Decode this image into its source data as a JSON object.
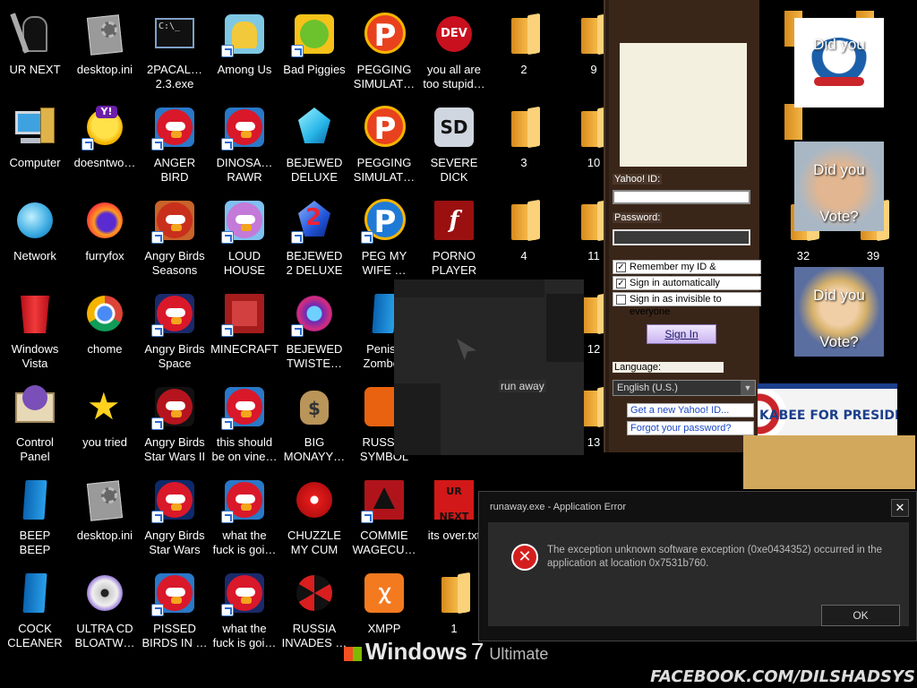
{
  "desktop": {
    "columns": [
      [
        {
          "label": "UR NEXT",
          "icon": "reaper-icon"
        },
        {
          "label": "Computer",
          "icon": "computer-icon"
        },
        {
          "label": "Network",
          "icon": "network-icon"
        },
        {
          "label": "Windows\nVista",
          "icon": "recycle-bin-icon"
        },
        {
          "label": "Control\nPanel",
          "icon": "control-panel-icon"
        },
        {
          "label": "BEEP\nBEEP",
          "icon": "blue-file-icon"
        },
        {
          "label": "COCK\nCLEANER",
          "icon": "blue-file-icon"
        }
      ],
      [
        {
          "label": "desktop.ini",
          "icon": "config-file-icon"
        },
        {
          "label": "doesntwo…",
          "icon": "yahoo-messenger-icon"
        },
        {
          "label": "furryfox",
          "icon": "firefox-icon"
        },
        {
          "label": "chome",
          "icon": "chrome-icon"
        },
        {
          "label": "you tried",
          "icon": "gold-star-icon"
        },
        {
          "label": "desktop.ini",
          "icon": "config-file-icon"
        },
        {
          "label": "ULTRA CD\nBLOATW…",
          "icon": "cd-icon"
        }
      ],
      [
        {
          "label": "2PACAL…\n2.3.exe",
          "icon": "terminal-icon"
        },
        {
          "label": "ANGER\nBIRD",
          "icon": "angry-bird-icon"
        },
        {
          "label": "Angry Birds\nSeasons",
          "icon": "angry-birds-seasons-icon"
        },
        {
          "label": "Angry Birds\nSpace",
          "icon": "angry-birds-space-icon"
        },
        {
          "label": "Angry Birds\nStar Wars II",
          "icon": "angry-birds-star-wars-icon"
        },
        {
          "label": "Angry Birds\nStar Wars",
          "icon": "angry-birds-star-wars-icon"
        },
        {
          "label": "PISSED\nBIRDS IN …",
          "icon": "angry-bird-icon"
        }
      ],
      [
        {
          "label": "Among Us",
          "icon": "among-us-icon"
        },
        {
          "label": "DINOSA…\nRAWR",
          "icon": "angry-bird-icon"
        },
        {
          "label": "LOUD\nHOUSE",
          "icon": "angry-birds-rio-icon"
        },
        {
          "label": "MINECRAFT",
          "icon": "minecraft-icon"
        },
        {
          "label": "this should\nbe on vine…",
          "icon": "angry-bird-icon"
        },
        {
          "label": "what the\nfuck is goi…",
          "icon": "angry-bird-icon"
        },
        {
          "label": "what the\nfuck is goi…",
          "icon": "angry-birds-space-icon"
        }
      ],
      [
        {
          "label": "Bad Piggies",
          "icon": "bad-piggies-icon"
        },
        {
          "label": "BEJEWED\nDELUXE",
          "icon": "diamond-icon"
        },
        {
          "label": "BEJEWED\n2 DELUXE",
          "icon": "bejeweled-2-icon"
        },
        {
          "label": "BEJEWED\nTWISTE…",
          "icon": "bejeweled-twist-icon"
        },
        {
          "label": "BIG\nMONAYY…",
          "icon": "money-bag-icon"
        },
        {
          "label": "CHUZZLE\nMY CUM",
          "icon": "chuzzle-icon"
        },
        {
          "label": "RUSSIA\nINVADES …",
          "icon": "radiation-icon"
        }
      ],
      [
        {
          "label": "PEGGING\nSIMULAT…",
          "icon": "peggle-icon"
        },
        {
          "label": "PEGGING\nSIMULAT…",
          "icon": "peggle-icon"
        },
        {
          "label": "PEG MY\nWIFE …",
          "icon": "peggle-icon"
        },
        {
          "label": "Penise\nZomboc",
          "icon": "blue-file-icon"
        },
        {
          "label": "RUSS…\nSYMBOL",
          "icon": "orange-icon"
        },
        {
          "label": "COMMIE\nWAGECU…",
          "icon": "commie-icon"
        },
        {
          "label": "XMPP",
          "icon": "xampp-icon"
        }
      ],
      [
        {
          "label": "you all are\ntoo stupid…",
          "icon": "dev-cpp-icon"
        },
        {
          "label": "SEVERE\nDICK",
          "icon": "sd-icon"
        },
        {
          "label": "PORNO\nPLAYER",
          "icon": "flash-icon"
        },
        {
          "label": "its over.txt",
          "icon": "ur-next-icon"
        },
        {
          "label": "1",
          "icon": "folder-icon"
        }
      ],
      [
        {
          "label": "2",
          "icon": "folder-icon"
        },
        {
          "label": "3",
          "icon": "folder-icon"
        },
        {
          "label": "4",
          "icon": "folder-icon"
        }
      ],
      [
        {
          "label": "9",
          "icon": "folder-icon"
        },
        {
          "label": "10",
          "icon": "folder-icon"
        },
        {
          "label": "11",
          "icon": "folder-icon"
        },
        {
          "label": "12",
          "icon": "folder-icon"
        },
        {
          "label": "13",
          "icon": "folder-icon"
        }
      ],
      [
        {
          "label": "32",
          "icon": "folder-icon"
        }
      ],
      [
        {
          "label": "39",
          "icon": "folder-icon"
        }
      ]
    ]
  },
  "runaway_popup": {
    "label": "run away"
  },
  "yahoo": {
    "id_label": "Yahoo! ID:",
    "id_value": "",
    "password_label": "Password:",
    "password_value": "",
    "remember_label": "Remember my ID & password",
    "remember_checked": true,
    "auto_label": "Sign in automatically",
    "auto_checked": true,
    "invisible_label": "Sign in as invisible to everyone",
    "invisible_checked": false,
    "sign_in_label": "Sign In",
    "language_label": "Language:",
    "language_value": "English (U.S.)",
    "get_id_link": "Get a new Yahoo! ID...",
    "forgot_link": "Forgot your password?"
  },
  "campaign": {
    "did_you": "Did you",
    "vote": "Vote?",
    "huckabee": "KABEE  FOR PRESIDENT"
  },
  "error_dialog": {
    "title": "runaway.exe - Application Error",
    "message": "The exception unknown software exception (0xe0434352) occurred in the application at location 0x7531b760.",
    "ok_label": "OK",
    "close_glyph": "✕"
  },
  "branding": {
    "windows": "Windows",
    "version": "7",
    "edition": "Ultimate",
    "watermark": "FACEBOOK.COM/DILSHADSYS"
  },
  "colors": {
    "desktop_bg": "#000000",
    "error_red": "#d41e1e",
    "yahoo_brown": "#3a2619",
    "link_blue": "#1b48c8"
  }
}
